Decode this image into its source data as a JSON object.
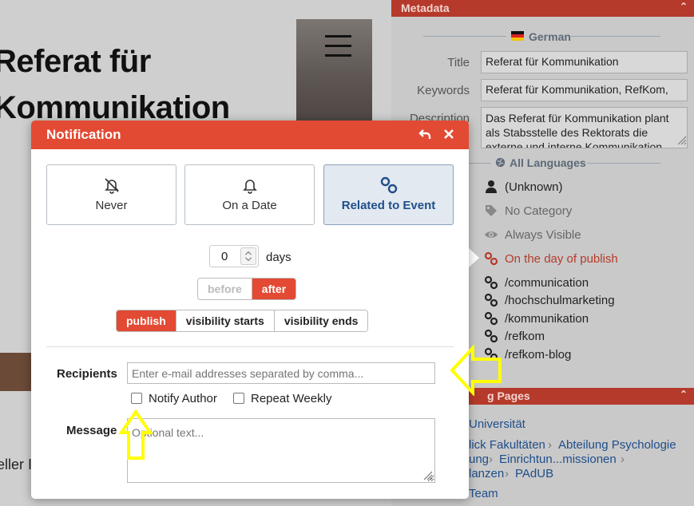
{
  "background_page": {
    "title_line1": "Referat für",
    "title_line2": "Kommunikation",
    "text_fragment": "eller I"
  },
  "metadata": {
    "header": "Metadata",
    "language": "German",
    "fields": [
      {
        "label": "Title",
        "value": "Referat für Kommunikation"
      },
      {
        "label": "Keywords",
        "value": "Referat für Kommunikation, RefKom,"
      },
      {
        "label": "Description",
        "value": "Das Referat für Kommunikation plant als Stabsstelle des Rektorats die externe und interne Kommunikation"
      }
    ],
    "all_languages": "All Languages",
    "author": "(Unknown)",
    "category": "No Category",
    "visibility": "Always Visible",
    "publish_rule": "On the day of publish",
    "aliases": [
      "/communication",
      "/hochschulmarketing",
      "/kommunikation",
      "/refkom",
      "/refkom-blog"
    ]
  },
  "linking_pages": {
    "header": "g Pages",
    "items": [
      "Universität",
      "lick Fakultäten",
      "Abteilung Psychologie",
      "ung",
      "Einrichtun...missionen",
      "lanzen",
      "PAdUB",
      "Team"
    ]
  },
  "modal": {
    "title": "Notification",
    "choices": [
      {
        "label": "Never",
        "icon": "bell-slash-icon",
        "active": false
      },
      {
        "label": "On a Date",
        "icon": "bell-icon",
        "active": false
      },
      {
        "label": "Related to Event",
        "icon": "link-icon",
        "active": true
      }
    ],
    "days_value": "0",
    "days_label": "days",
    "before_label": "before",
    "after_label": "after",
    "event_options": [
      "publish",
      "visibility starts",
      "visibility ends"
    ],
    "recipients_label": "Recipients",
    "recipients_placeholder": "Enter e-mail addresses separated by comma...",
    "notify_author_label": "Notify Author",
    "repeat_weekly_label": "Repeat Weekly",
    "message_label": "Message",
    "message_placeholder": "Optional text..."
  },
  "colors": {
    "accent": "#e24a33",
    "metadata_header": "#b53a2b",
    "active_choice_bg": "#e3e9f0",
    "link_blue": "#1f4e8a",
    "highlight_arrow": "#ffff00"
  }
}
